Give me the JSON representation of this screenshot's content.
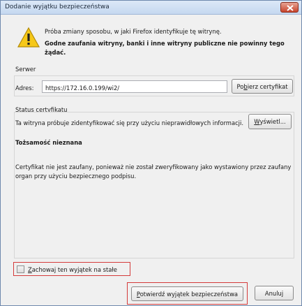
{
  "dialog": {
    "title": "Dodanie wyjątku bezpieczeństwa"
  },
  "message": {
    "line1": "Próba zmiany sposobu, w jaki Firefox identyfikuje tę witrynę.",
    "line2": "Godne zaufania witryny, banki i inne witryny publiczne nie powinny tego żądać."
  },
  "server": {
    "section_label": "Serwer",
    "address_label": "Adres:",
    "address_value": "https://172.16.0.199/wi2/",
    "get_cert_button": {
      "prefix": "Po",
      "accel": "b",
      "rest": "ierz certyfikat"
    }
  },
  "cert_status": {
    "section_label": "Status certyfikatu",
    "text": "Ta witryna próbuje zidentyfikować się przy użyciu nieprawidłowych informacji.",
    "view_button": {
      "prefix": "",
      "accel": "W",
      "rest": "yświetl..."
    },
    "identity_title": "Tożsamość nieznana",
    "identity_text": "Certyfikat nie jest zaufany, ponieważ nie został zweryfikowany jako wystawiony przez zaufany organ przy użyciu bezpiecznego podpisu."
  },
  "options": {
    "keep_checkbox": {
      "accel": "Z",
      "rest": "achowaj ten wyjątek na stałe",
      "checked": false
    }
  },
  "buttons": {
    "confirm": {
      "accel": "P",
      "rest": "otwierdź wyjątek bezpieczeństwa"
    },
    "cancel": "Anuluj"
  },
  "colors": {
    "highlight_border": "#d43a3a",
    "warning_yellow": "#f6c819"
  }
}
